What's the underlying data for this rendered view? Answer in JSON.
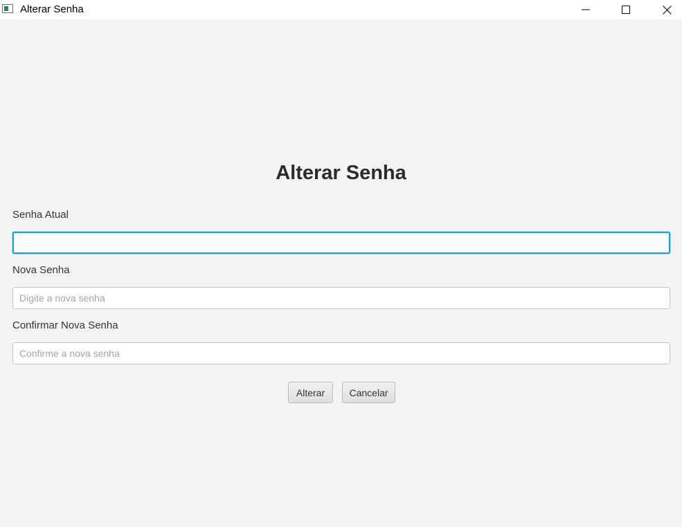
{
  "window": {
    "title": "Alterar Senha",
    "icons": [
      "app-icon",
      "minimize-icon",
      "maximize-icon",
      "close-icon"
    ]
  },
  "form": {
    "heading": "Alterar Senha",
    "current_password": {
      "label": "Senha Atual",
      "value": "",
      "placeholder": ""
    },
    "new_password": {
      "label": "Nova Senha",
      "value": "",
      "placeholder": "Digite a nova senha"
    },
    "confirm_password": {
      "label": "Confirmar Nova Senha",
      "value": "",
      "placeholder": "Confirme a nova senha"
    }
  },
  "actions": {
    "submit_label": "Alterar",
    "cancel_label": "Cancelar"
  },
  "colors": {
    "background": "#f4f4f4",
    "focus_accent": "#1e9ed8"
  }
}
